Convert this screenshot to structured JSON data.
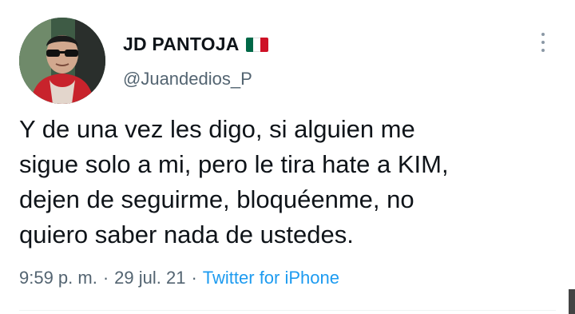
{
  "author": {
    "display_name": "JD PANTOJA",
    "handle": "@Juandedios_P",
    "flag_icon": "mexico-flag-icon",
    "flag_colors": [
      "#006847",
      "#ffffff",
      "#ce1126"
    ]
  },
  "tweet": {
    "text": "Y de una vez les digo, si alguien me\nsigue solo a mi, pero le tira hate a KIM,\ndejen de seguirme, bloquéenme, no\nquiero saber nada de ustedes.",
    "time": "9:59 p. m.",
    "separator": "·",
    "date": "29 jul. 21",
    "source": "Twitter for iPhone"
  },
  "icons": {
    "more": "more-vertical-icon"
  },
  "colors": {
    "text": "#0f1419",
    "secondary": "#536471",
    "link": "#1d9bf0"
  }
}
